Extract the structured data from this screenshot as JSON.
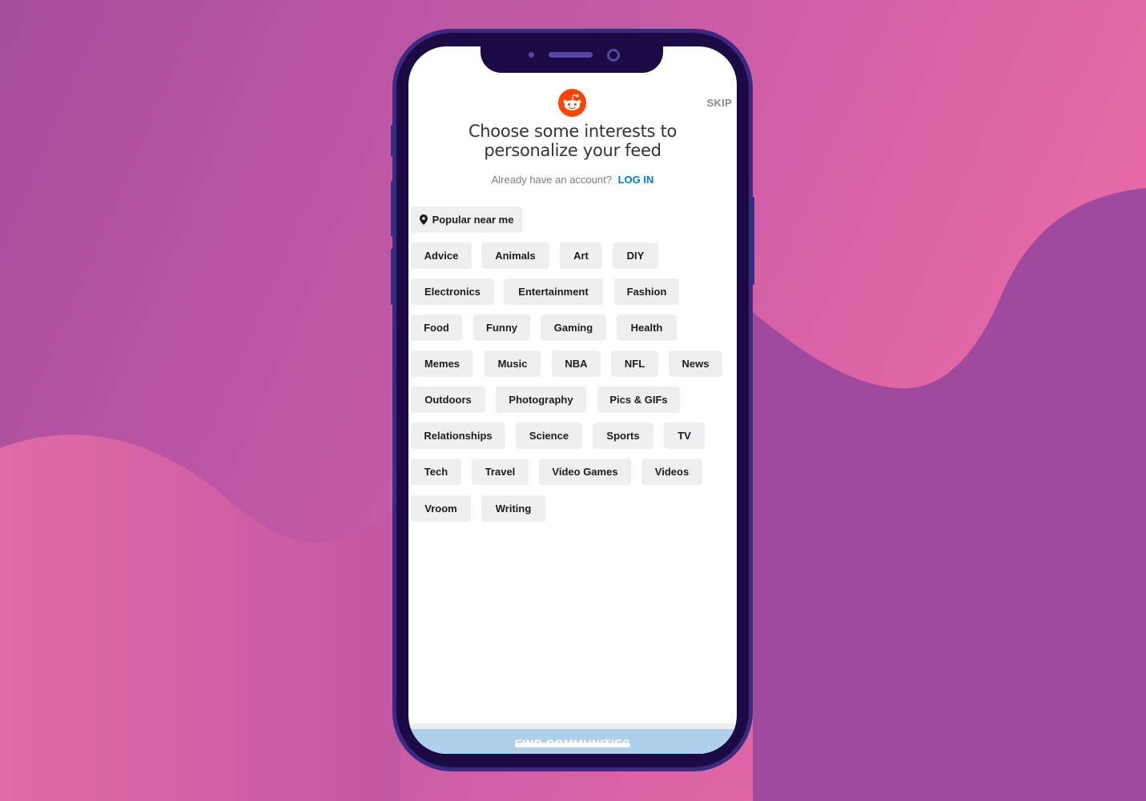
{
  "background": {
    "colors": {
      "dark_wave": "#9b469c",
      "pink": "#e06aa6"
    }
  },
  "app": {
    "logo": "reddit-logo",
    "skip_label": "SKIP",
    "title": "Choose some interests to personalize your feed",
    "login_prompt": "Already have an account?",
    "login_label": "LOG IN",
    "accent_color": "#0079d3",
    "brand_color": "#ff4500",
    "popular_label": "Popular near me",
    "interests": [
      "Advice",
      "Animals",
      "Art",
      "DIY",
      "Electronics",
      "Entertainment",
      "Fashion",
      "Food",
      "Funny",
      "Gaming",
      "Health",
      "Memes",
      "Music",
      "NBA",
      "NFL",
      "News",
      "Outdoors",
      "Photography",
      "Pics & GIFs",
      "Relationships",
      "Science",
      "Sports",
      "TV",
      "Tech",
      "Travel",
      "Video Games",
      "Videos",
      "Vroom",
      "Writing"
    ],
    "bottom_button_label": "FIND COMMUNITIES"
  }
}
